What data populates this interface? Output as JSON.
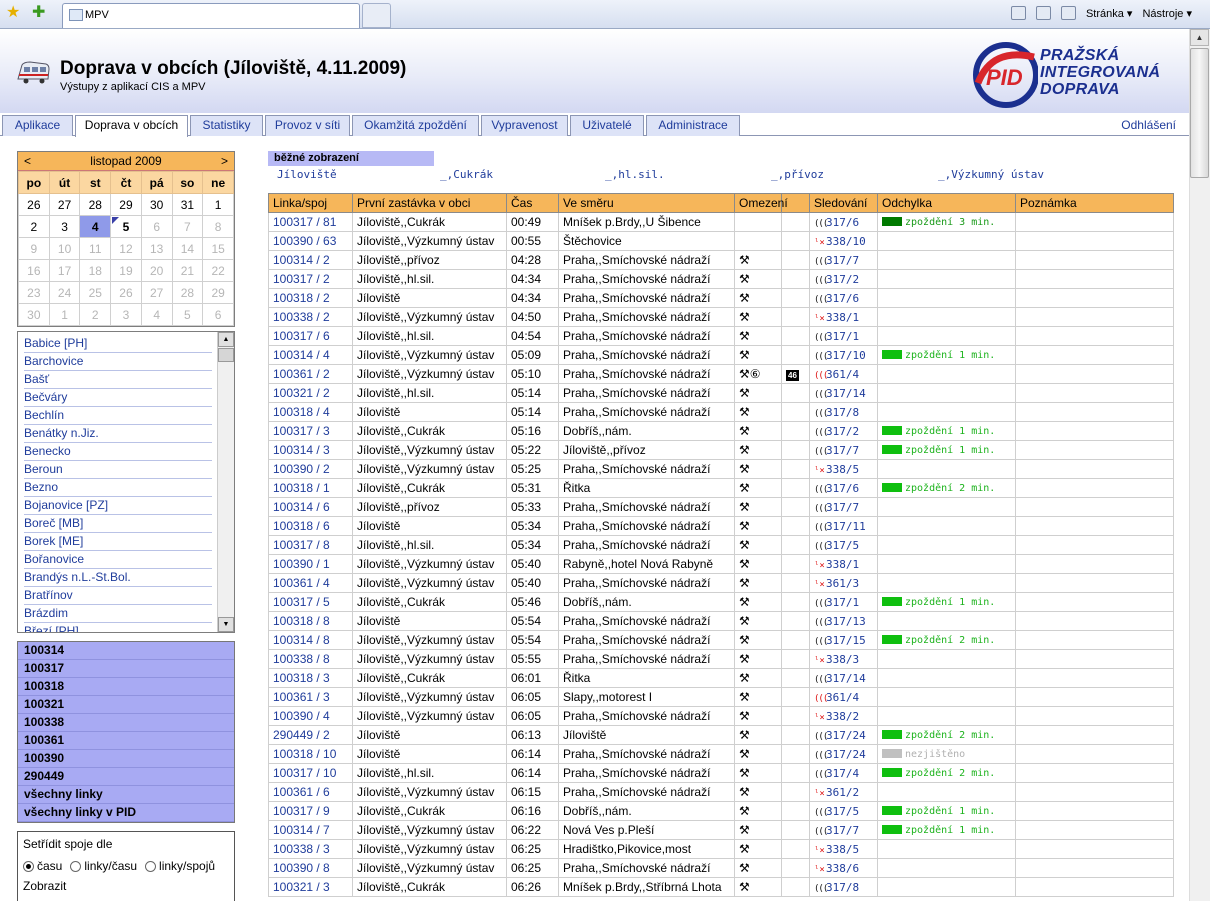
{
  "browser": {
    "tab_title": "MPV",
    "tab_favicon": "MPV",
    "home_icon": "home-icon",
    "page_menu": "Stránka ▾",
    "tools_menu": "Nástroje ▾"
  },
  "header": {
    "title": "Doprava v obcích (Jíloviště, 4.11.2009)",
    "subtitle": "Výstupy z aplikací CIS a MPV",
    "logo_mark": "PID",
    "logo_lines": [
      "PRAŽSKÁ",
      "INTEGROVANÁ",
      "DOPRAVA"
    ]
  },
  "tabs": [
    "Aplikace",
    "Doprava v obcích",
    "Statistiky",
    "Provoz v síti",
    "Okamžitá zpoždění",
    "Vypravenost",
    "Uživatelé",
    "Administrace"
  ],
  "active_tab": "Doprava v obcích",
  "logout": "Odhlášení",
  "calendar": {
    "prev": "<",
    "next": ">",
    "month": "listopad 2009",
    "weekdays": [
      "po",
      "út",
      "st",
      "čt",
      "pá",
      "so",
      "ne"
    ],
    "weeks": [
      [
        "26",
        "27",
        "28",
        "29",
        "30",
        "31",
        "1"
      ],
      [
        "2",
        "3",
        "4",
        "5",
        "6",
        "7",
        "8"
      ],
      [
        "9",
        "10",
        "11",
        "12",
        "13",
        "14",
        "15"
      ],
      [
        "16",
        "17",
        "18",
        "19",
        "20",
        "21",
        "22"
      ],
      [
        "23",
        "24",
        "25",
        "26",
        "27",
        "28",
        "29"
      ],
      [
        "30",
        "1",
        "2",
        "3",
        "4",
        "5",
        "6"
      ]
    ],
    "selected": "4",
    "today": "5"
  },
  "towns": [
    "Babice [PH]",
    "Barchovice",
    "Bašť",
    "Bečváry",
    "Bechlín",
    "Benátky n.Jiz.",
    "Benecko",
    "Beroun",
    "Bezno",
    "Bojanovice [PZ]",
    "Boreč [MB]",
    "Borek [ME]",
    "Bořanovice",
    "Brandýs n.L.-St.Bol.",
    "Bratřínov",
    "Brázdim",
    "Březí [PH]"
  ],
  "lines": [
    "100314",
    "100317",
    "100318",
    "100321",
    "100338",
    "100361",
    "100390",
    "290449",
    "všechny linky",
    "všechny linky v PID"
  ],
  "sort": {
    "title": "Setřídit spoje dle",
    "options": [
      "času",
      "linky/času",
      "linky/spojů"
    ],
    "selected": 0,
    "show_label": "Zobrazit"
  },
  "stop_nav": {
    "current": "běžné zobrazení",
    "links": [
      "Jíloviště",
      "_,Cukrák",
      "_,hl.sil.",
      "_,přívoz",
      "_,Výzkumný ústav"
    ]
  },
  "table": {
    "headers": [
      "Linka/spoj",
      "První zastávka v obci",
      "Čas",
      "Ve směru",
      "Omezení",
      "",
      "Sledování",
      "Odchylka",
      "Poznámka"
    ],
    "status_colors": {
      "delay3": "#007a00",
      "delay": "#0fbf0f",
      "unknown": "#c0c0c0"
    },
    "rows": [
      {
        "line": "100317 / 81",
        "first": "Jíloviště,,Cukrák",
        "time": "00:49",
        "dir": "Mníšek p.Brdy,,U Šibence",
        "om": "",
        "badge": "",
        "sig": "signal",
        "track": "317/6",
        "dev": "zpoždění 3 min.",
        "dev_type": "delay3"
      },
      {
        "line": "100390 / 63",
        "first": "Jíloviště,,Výzkumný ústav",
        "time": "00:55",
        "dir": "Štěchovice",
        "om": "",
        "badge": "",
        "sig": "lost",
        "track": "338/10",
        "dev": "",
        "dev_type": ""
      },
      {
        "line": "100314 / 2",
        "first": "Jíloviště,,přívoz",
        "time": "04:28",
        "dir": "Praha,,Smíchovské nádraží",
        "om": "⚒",
        "badge": "",
        "sig": "signal",
        "track": "317/7",
        "dev": "",
        "dev_type": ""
      },
      {
        "line": "100317 / 2",
        "first": "Jíloviště,,hl.sil.",
        "time": "04:34",
        "dir": "Praha,,Smíchovské nádraží",
        "om": "⚒",
        "badge": "",
        "sig": "signal",
        "track": "317/2",
        "dev": "",
        "dev_type": ""
      },
      {
        "line": "100318 / 2",
        "first": "Jíloviště",
        "time": "04:34",
        "dir": "Praha,,Smíchovské nádraží",
        "om": "⚒",
        "badge": "",
        "sig": "signal",
        "track": "317/6",
        "dev": "",
        "dev_type": ""
      },
      {
        "line": "100338 / 2",
        "first": "Jíloviště,,Výzkumný ústav",
        "time": "04:50",
        "dir": "Praha,,Smíchovské nádraží",
        "om": "⚒",
        "badge": "",
        "sig": "lost",
        "track": "338/1",
        "dev": "",
        "dev_type": ""
      },
      {
        "line": "100317 / 6",
        "first": "Jíloviště,,hl.sil.",
        "time": "04:54",
        "dir": "Praha,,Smíchovské nádraží",
        "om": "⚒",
        "badge": "",
        "sig": "signal",
        "track": "317/1",
        "dev": "",
        "dev_type": ""
      },
      {
        "line": "100314 / 4",
        "first": "Jíloviště,,Výzkumný ústav",
        "time": "05:09",
        "dir": "Praha,,Smíchovské nádraží",
        "om": "⚒",
        "badge": "",
        "sig": "signal",
        "track": "317/10",
        "dev": "zpoždění 1 min.",
        "dev_type": "delay"
      },
      {
        "line": "100361 / 2",
        "first": "Jíloviště,,Výzkumný ústav",
        "time": "05:10",
        "dir": "Praha,,Smíchovské nádraží",
        "om": "⚒⑥",
        "badge": "46",
        "sig": "red",
        "track": "361/4",
        "dev": "",
        "dev_type": ""
      },
      {
        "line": "100321 / 2",
        "first": "Jíloviště,,hl.sil.",
        "time": "05:14",
        "dir": "Praha,,Smíchovské nádraží",
        "om": "⚒",
        "badge": "",
        "sig": "signal",
        "track": "317/14",
        "dev": "",
        "dev_type": ""
      },
      {
        "line": "100318 / 4",
        "first": "Jíloviště",
        "time": "05:14",
        "dir": "Praha,,Smíchovské nádraží",
        "om": "⚒",
        "badge": "",
        "sig": "signal",
        "track": "317/8",
        "dev": "",
        "dev_type": ""
      },
      {
        "line": "100317 / 3",
        "first": "Jíloviště,,Cukrák",
        "time": "05:16",
        "dir": "Dobříš,,nám.",
        "om": "⚒",
        "badge": "",
        "sig": "signal",
        "track": "317/2",
        "dev": "zpoždění 1 min.",
        "dev_type": "delay"
      },
      {
        "line": "100314 / 3",
        "first": "Jíloviště,,Výzkumný ústav",
        "time": "05:22",
        "dir": "Jíloviště,,přívoz",
        "om": "⚒",
        "badge": "",
        "sig": "signal",
        "track": "317/7",
        "dev": "zpoždění 1 min.",
        "dev_type": "delay"
      },
      {
        "line": "100390 / 2",
        "first": "Jíloviště,,Výzkumný ústav",
        "time": "05:25",
        "dir": "Praha,,Smíchovské nádraží",
        "om": "⚒",
        "badge": "",
        "sig": "lost",
        "track": "338/5",
        "dev": "",
        "dev_type": ""
      },
      {
        "line": "100318 / 1",
        "first": "Jíloviště,,Cukrák",
        "time": "05:31",
        "dir": "Řitka",
        "om": "⚒",
        "badge": "",
        "sig": "signal",
        "track": "317/6",
        "dev": "zpoždění 2 min.",
        "dev_type": "delay"
      },
      {
        "line": "100314 / 6",
        "first": "Jíloviště,,přívoz",
        "time": "05:33",
        "dir": "Praha,,Smíchovské nádraží",
        "om": "⚒",
        "badge": "",
        "sig": "signal",
        "track": "317/7",
        "dev": "",
        "dev_type": ""
      },
      {
        "line": "100318 / 6",
        "first": "Jíloviště",
        "time": "05:34",
        "dir": "Praha,,Smíchovské nádraží",
        "om": "⚒",
        "badge": "",
        "sig": "signal",
        "track": "317/11",
        "dev": "",
        "dev_type": ""
      },
      {
        "line": "100317 / 8",
        "first": "Jíloviště,,hl.sil.",
        "time": "05:34",
        "dir": "Praha,,Smíchovské nádraží",
        "om": "⚒",
        "badge": "",
        "sig": "signal",
        "track": "317/5",
        "dev": "",
        "dev_type": ""
      },
      {
        "line": "100390 / 1",
        "first": "Jíloviště,,Výzkumný ústav",
        "time": "05:40",
        "dir": "Rabyně,,hotel Nová Rabyně",
        "om": "⚒",
        "badge": "",
        "sig": "lost",
        "track": "338/1",
        "dev": "",
        "dev_type": ""
      },
      {
        "line": "100361 / 4",
        "first": "Jíloviště,,Výzkumný ústav",
        "time": "05:40",
        "dir": "Praha,,Smíchovské nádraží",
        "om": "⚒",
        "badge": "",
        "sig": "lost",
        "track": "361/3",
        "dev": "",
        "dev_type": ""
      },
      {
        "line": "100317 / 5",
        "first": "Jíloviště,,Cukrák",
        "time": "05:46",
        "dir": "Dobříš,,nám.",
        "om": "⚒",
        "badge": "",
        "sig": "signal",
        "track": "317/1",
        "dev": "zpoždění 1 min.",
        "dev_type": "delay"
      },
      {
        "line": "100318 / 8",
        "first": "Jíloviště",
        "time": "05:54",
        "dir": "Praha,,Smíchovské nádraží",
        "om": "⚒",
        "badge": "",
        "sig": "signal",
        "track": "317/13",
        "dev": "",
        "dev_type": ""
      },
      {
        "line": "100314 / 8",
        "first": "Jíloviště,,Výzkumný ústav",
        "time": "05:54",
        "dir": "Praha,,Smíchovské nádraží",
        "om": "⚒",
        "badge": "",
        "sig": "signal",
        "track": "317/15",
        "dev": "zpoždění 2 min.",
        "dev_type": "delay"
      },
      {
        "line": "100338 / 8",
        "first": "Jíloviště,,Výzkumný ústav",
        "time": "05:55",
        "dir": "Praha,,Smíchovské nádraží",
        "om": "⚒",
        "badge": "",
        "sig": "lost",
        "track": "338/3",
        "dev": "",
        "dev_type": ""
      },
      {
        "line": "100318 / 3",
        "first": "Jíloviště,,Cukrák",
        "time": "06:01",
        "dir": "Řitka",
        "om": "⚒",
        "badge": "",
        "sig": "signal",
        "track": "317/14",
        "dev": "",
        "dev_type": ""
      },
      {
        "line": "100361 / 3",
        "first": "Jíloviště,,Výzkumný ústav",
        "time": "06:05",
        "dir": "Slapy,,motorest I",
        "om": "⚒",
        "badge": "",
        "sig": "red",
        "track": "361/4",
        "dev": "",
        "dev_type": ""
      },
      {
        "line": "100390 / 4",
        "first": "Jíloviště,,Výzkumný ústav",
        "time": "06:05",
        "dir": "Praha,,Smíchovské nádraží",
        "om": "⚒",
        "badge": "",
        "sig": "lost",
        "track": "338/2",
        "dev": "",
        "dev_type": ""
      },
      {
        "line": "290449 / 2",
        "first": "Jíloviště",
        "time": "06:13",
        "dir": "Jíloviště",
        "om": "⚒",
        "badge": "",
        "sig": "signal",
        "track": "317/24",
        "dev": "zpoždění 2 min.",
        "dev_type": "delay"
      },
      {
        "line": "100318 / 10",
        "first": "Jíloviště",
        "time": "06:14",
        "dir": "Praha,,Smíchovské nádraží",
        "om": "⚒",
        "badge": "",
        "sig": "signal",
        "track": "317/24",
        "dev": "nezjištěno",
        "dev_type": "unknown"
      },
      {
        "line": "100317 / 10",
        "first": "Jíloviště,,hl.sil.",
        "time": "06:14",
        "dir": "Praha,,Smíchovské nádraží",
        "om": "⚒",
        "badge": "",
        "sig": "signal",
        "track": "317/4",
        "dev": "zpoždění 2 min.",
        "dev_type": "delay"
      },
      {
        "line": "100361 / 6",
        "first": "Jíloviště,,Výzkumný ústav",
        "time": "06:15",
        "dir": "Praha,,Smíchovské nádraží",
        "om": "⚒",
        "badge": "",
        "sig": "lost",
        "track": "361/2",
        "dev": "",
        "dev_type": ""
      },
      {
        "line": "100317 / 9",
        "first": "Jíloviště,,Cukrák",
        "time": "06:16",
        "dir": "Dobříš,,nám.",
        "om": "⚒",
        "badge": "",
        "sig": "signal",
        "track": "317/5",
        "dev": "zpoždění 1 min.",
        "dev_type": "delay"
      },
      {
        "line": "100314 / 7",
        "first": "Jíloviště,,Výzkumný ústav",
        "time": "06:22",
        "dir": "Nová Ves p.Pleší",
        "om": "⚒",
        "badge": "",
        "sig": "signal",
        "track": "317/7",
        "dev": "zpoždění 1 min.",
        "dev_type": "delay"
      },
      {
        "line": "100338 / 3",
        "first": "Jíloviště,,Výzkumný ústav",
        "time": "06:25",
        "dir": "Hradištko,Pikovice,most",
        "om": "⚒",
        "badge": "",
        "sig": "lost",
        "track": "338/5",
        "dev": "",
        "dev_type": ""
      },
      {
        "line": "100390 / 8",
        "first": "Jíloviště,,Výzkumný ústav",
        "time": "06:25",
        "dir": "Praha,,Smíchovské nádraží",
        "om": "⚒",
        "badge": "",
        "sig": "lost",
        "track": "338/6",
        "dev": "",
        "dev_type": ""
      },
      {
        "line": "100321 / 3",
        "first": "Jíloviště,,Cukrák",
        "time": "06:26",
        "dir": "Mníšek p.Brdy,,Stříbrná Lhota",
        "om": "⚒",
        "badge": "",
        "sig": "signal",
        "track": "317/8",
        "dev": "",
        "dev_type": ""
      }
    ]
  }
}
